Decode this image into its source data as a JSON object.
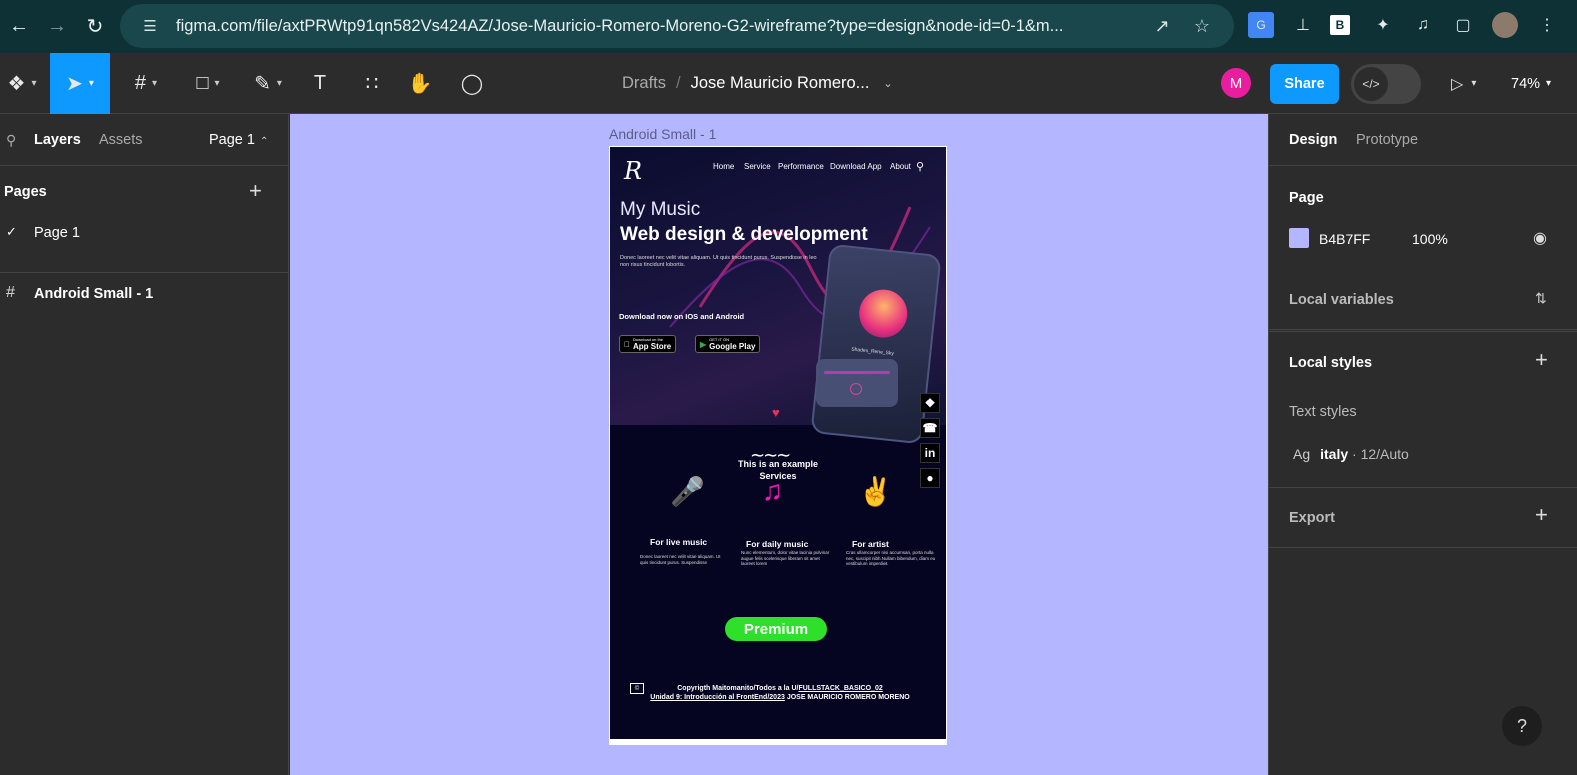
{
  "browser": {
    "url": "figma.com/file/axtPRWtp91qn582Vs424AZ/Jose-Mauricio-Romero-Moreno-G2-wireframe?type=design&node-id=0-1&m..."
  },
  "toolbar": {
    "breadcrumb_drafts": "Drafts",
    "file_name": "Jose Mauricio Romero...",
    "avatar_initial": "M",
    "share_label": "Share",
    "zoom": "74%"
  },
  "left_panel": {
    "tab_layers": "Layers",
    "tab_assets": "Assets",
    "page_selector": "Page 1",
    "pages_heading": "Pages",
    "pages": [
      {
        "label": "Page 1",
        "selected": true
      }
    ],
    "layers": [
      {
        "label": "Android Small - 1",
        "type": "frame"
      }
    ]
  },
  "canvas": {
    "background": "#b4b7ff",
    "frame_label": "Android Small - 1",
    "mockup": {
      "logo": "R",
      "nav": [
        "Home",
        "Service",
        "Performance",
        "Download App",
        "About"
      ],
      "hero_small": "My Music",
      "hero_big": "Web design & development",
      "hero_lorem": "Donec laoreet nec velit vitae aliquam. Ut quis tincidunt purus. Suspendisse in leo non risus tincidunt lobortis.",
      "download_text": "Download now on IOS and Android",
      "app_store_small": "Download on the",
      "app_store": "App Store",
      "google_play_small": "GET IT ON",
      "google_play": "Google Play",
      "phone_song": "Shades_Rene_Sky",
      "services_title": "This is an example Services",
      "services": [
        {
          "title": "For live music",
          "text": "Donec laoreet nec velit vitae aliquam. Ut quis tincidunt purus. Suspendisse"
        },
        {
          "title": "For daily music",
          "text": "Nunc elementum, dolor vitae lacinia pulvinar augue felis scelerisque liberam sit amet laoreet lorem"
        },
        {
          "title": "For artist",
          "text": "Cras ullamcorper nisi accumsan, porta nulla nec, suscipit nibh.Nullam bibendum, diam eu vestibulum imperdiet."
        }
      ],
      "premium": "Premium",
      "copyright_line1": "Copyrigth Maitomanito/Todos a la U/",
      "copyright_link1": "FULLSTACK_BASICO_02",
      "copyright_link2": "Unidad 9: Introducción al FrontEnd/2023",
      "copyright_line3": "JOSE MAURICIO ROMERO MORENO"
    }
  },
  "right_panel": {
    "tab_design": "Design",
    "tab_prototype": "Prototype",
    "page_heading": "Page",
    "page_color_hex": "B4B7FF",
    "page_color_opacity": "100%",
    "local_variables": "Local variables",
    "local_styles": "Local styles",
    "text_styles_heading": "Text styles",
    "text_style_preview": "Ag",
    "text_style_name": "italy",
    "text_style_meta": " · 12/Auto",
    "export": "Export"
  },
  "help_label": "?"
}
